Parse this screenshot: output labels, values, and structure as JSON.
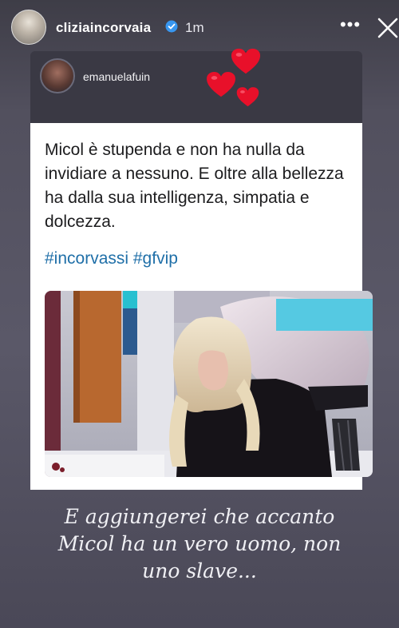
{
  "header": {
    "username": "cliziaincorvaia",
    "time": "1m",
    "more_label": "•••",
    "close_label": "close",
    "verified_icon": "verified-badge-icon"
  },
  "reshare": {
    "username": "emanuelafuin",
    "caption": "Micol è stupenda e non ha nulla da invidiare a nessuno. E oltre alla bellezza ha dalla sua intelligenza, simpatia e dolcezza.",
    "hashtags": "#incorvassi #gfvip",
    "photo_icon": "photo-image"
  },
  "story_text": {
    "line1": "E aggiungerei che accanto",
    "line2": "Micol ha un vero uomo, non",
    "line3": "uno slave..."
  },
  "colors": {
    "background": "#4d4b58",
    "heart": "#e8102a",
    "hashtag": "#1f6fa8",
    "verified": "#3897f0"
  }
}
